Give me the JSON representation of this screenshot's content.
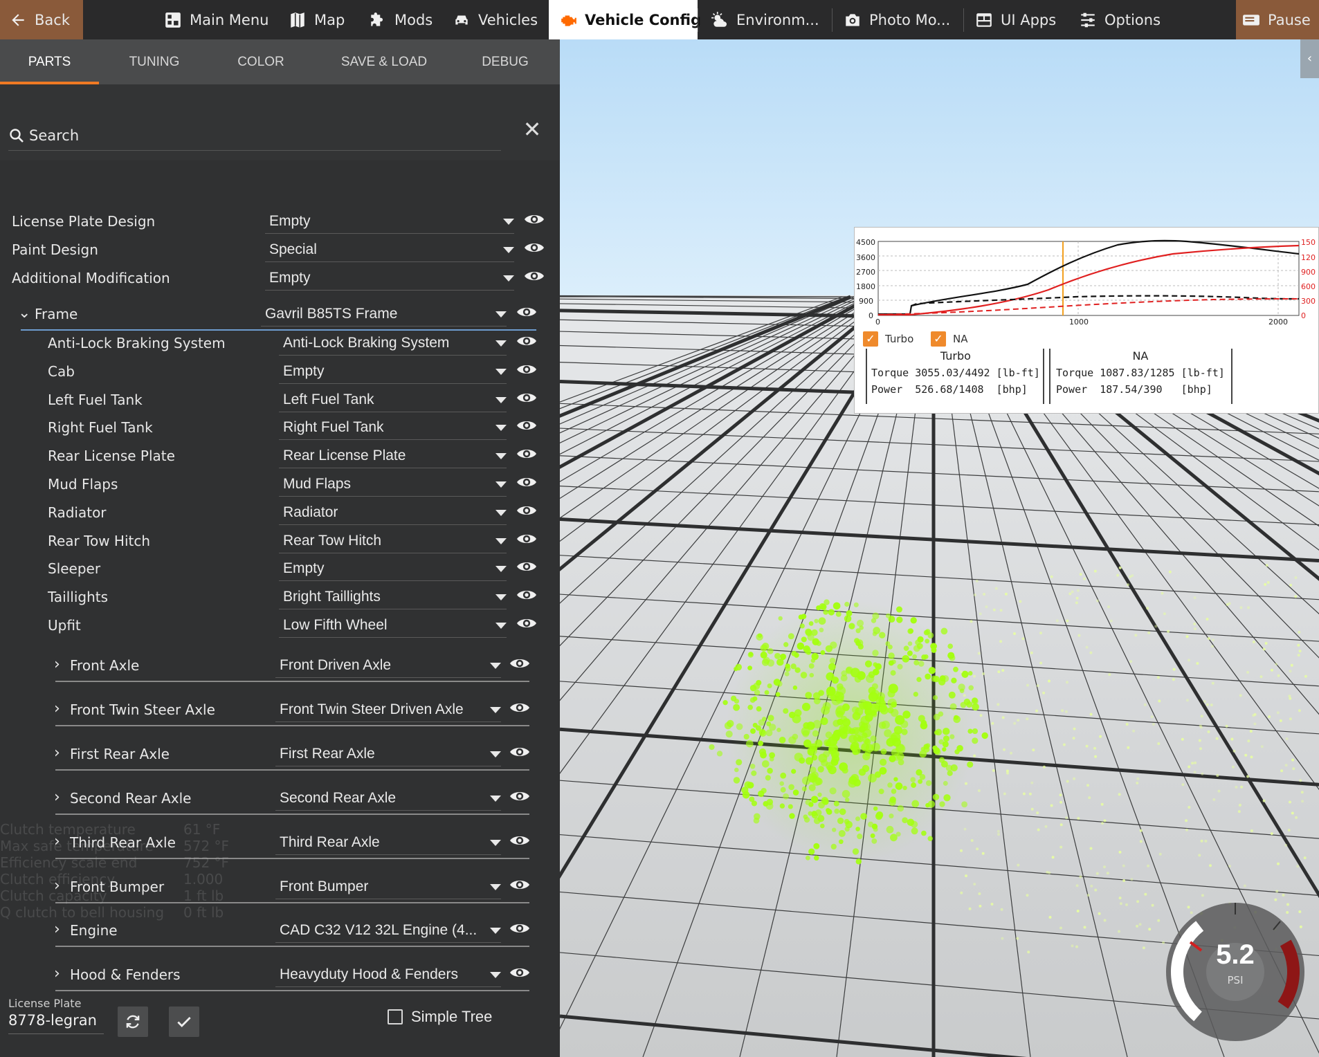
{
  "topbar": {
    "back": "Back",
    "main_menu": "Main Menu",
    "map": "Map",
    "mods": "Mods",
    "vehicles": "Vehicles",
    "vehicle_config": "Vehicle Config",
    "environment": "Environm...",
    "photo_mode": "Photo Mo...",
    "ui_apps": "UI Apps",
    "options": "Options",
    "pause": "Pause",
    "accent_color": "#ff6a00"
  },
  "tabs": [
    "PARTS",
    "TUNING",
    "COLOR",
    "SAVE & LOAD",
    "DEBUG"
  ],
  "search": {
    "label": "Search"
  },
  "parts": {
    "top": [
      {
        "label": "License Plate Design",
        "value": "Empty"
      },
      {
        "label": "Paint Design",
        "value": "Special"
      },
      {
        "label": "Additional Modification",
        "value": "Empty"
      }
    ],
    "frame": {
      "label": "Frame",
      "value": "Gavril B85TS Frame"
    },
    "frame_children": [
      {
        "label": "Anti-Lock Braking System",
        "value": "Anti-Lock Braking System"
      },
      {
        "label": "Cab",
        "value": "Empty"
      },
      {
        "label": "Left Fuel Tank",
        "value": "Left Fuel Tank"
      },
      {
        "label": "Right Fuel Tank",
        "value": "Right Fuel Tank"
      },
      {
        "label": "Rear License Plate",
        "value": "Rear License Plate"
      },
      {
        "label": "Mud Flaps",
        "value": "Mud Flaps"
      },
      {
        "label": "Radiator",
        "value": "Radiator"
      },
      {
        "label": "Rear Tow Hitch",
        "value": "Rear Tow Hitch"
      },
      {
        "label": "Sleeper",
        "value": "Empty"
      },
      {
        "label": "Taillights",
        "value": "Bright Taillights"
      },
      {
        "label": "Upfit",
        "value": "Low Fifth Wheel"
      }
    ],
    "expandable": [
      {
        "label": "Front Axle",
        "value": "Front Driven Axle"
      },
      {
        "label": "Front Twin Steer Axle",
        "value": "Front Twin Steer Driven Axle"
      },
      {
        "label": "First Rear Axle",
        "value": "First Rear Axle"
      },
      {
        "label": "Second Rear Axle",
        "value": "Second Rear Axle"
      },
      {
        "label": "Third Rear Axle",
        "value": "Third Rear Axle"
      },
      {
        "label": "Front Bumper",
        "value": "Front Bumper"
      },
      {
        "label": "Engine",
        "value": "CAD C32 V12 32L Engine (4..."
      },
      {
        "label": "Hood & Fenders",
        "value": "Heavyduty Hood & Fenders"
      }
    ]
  },
  "license": {
    "label": "License Plate",
    "value": "8778-legran"
  },
  "simple_tree": "Simple Tree",
  "torque_graph": {
    "y_left_ticks": [
      "4500",
      "3600",
      "2700",
      "1800",
      "900",
      "0"
    ],
    "y_right_ticks": [
      "150",
      "120",
      "900",
      "600",
      "300",
      "0"
    ],
    "x_ticks": [
      "0",
      "1000",
      "2000"
    ],
    "legend": [
      "Turbo",
      "NA"
    ],
    "turbo": {
      "header": "Turbo",
      "torque": "Torque 3055.03/4492 [lb-ft]",
      "power": "Power  526.68/1408  [bhp]"
    },
    "na": {
      "header": "NA",
      "torque": "Torque 1087.83/1285 [lb-ft]",
      "power": "Power  187.54/390   [bhp]"
    },
    "colors": {
      "torque": "#111111",
      "power": "#e02020",
      "rpm_marker": "#f2a020"
    }
  },
  "gauge": {
    "value": "5.2",
    "unit": "PSI"
  },
  "ghost_text": {
    "clutch_temp": "Clutch temperature",
    "clutch_temp_val": "61 °F",
    "max_safe": "Max safe temperature",
    "max_safe_val": "572 °F",
    "eff_scale": "Efficiency scale end",
    "eff_scale_val": "752 °F",
    "clutch_eff": "Clutch efficiency",
    "clutch_eff_val": "1.000",
    "clutch_cap": "Clutch capacity",
    "clutch_cap_val": "1 ft lb",
    "clutch_bell": "Q clutch to bell housing",
    "clutch_bell_val": "0 ft lb"
  }
}
